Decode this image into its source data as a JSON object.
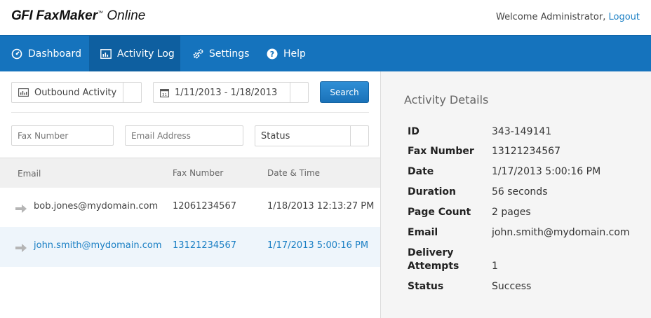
{
  "header": {
    "logo_gfi": "GFI",
    "logo_faxmaker": "FaxMaker",
    "logo_tm": "™",
    "logo_online": "Online",
    "welcome": "Welcome Administrator,",
    "logout": "Logout"
  },
  "nav": {
    "items": [
      {
        "label": "Dashboard",
        "icon": "dashboard-icon"
      },
      {
        "label": "Activity Log",
        "icon": "activity-log-icon",
        "active": true
      },
      {
        "label": "Settings",
        "icon": "settings-gears-icon"
      },
      {
        "label": "Help",
        "icon": "help-icon"
      }
    ]
  },
  "filters": {
    "activity_type": "Outbound Activity",
    "date_range": "1/11/2013 - 1/18/2013",
    "search_label": "Search",
    "fax_number_placeholder": "Fax Number",
    "email_placeholder": "Email Address",
    "status": "Status"
  },
  "table": {
    "columns": [
      "Email",
      "Fax Number",
      "Date & Time"
    ],
    "rows": [
      {
        "email": "bob.jones@mydomain.com",
        "fax": "12061234567",
        "datetime": "1/18/2013 12:13:27 PM"
      },
      {
        "email": "john.smith@mydomain.com",
        "fax": "13121234567",
        "datetime": "1/17/2013 5:00:16 PM",
        "selected": true
      }
    ]
  },
  "details": {
    "title": "Activity Details",
    "fields": [
      {
        "label": "ID",
        "value": "343-149141"
      },
      {
        "label": "Fax Number",
        "value": "13121234567"
      },
      {
        "label": "Date",
        "value": "1/17/2013 5:00:16 PM"
      },
      {
        "label": "Duration",
        "value": "56 seconds"
      },
      {
        "label": "Page Count",
        "value": "2 pages"
      },
      {
        "label": "Email",
        "value": "john.smith@mydomain.com"
      },
      {
        "label_line1": "Delivery",
        "label_line2": "Attempts",
        "value": "1"
      },
      {
        "label": "Status",
        "value": "Success"
      }
    ]
  },
  "colors": {
    "nav_bg": "#1573bd",
    "nav_active": "#0e5fa0",
    "link": "#1a7fc4"
  }
}
